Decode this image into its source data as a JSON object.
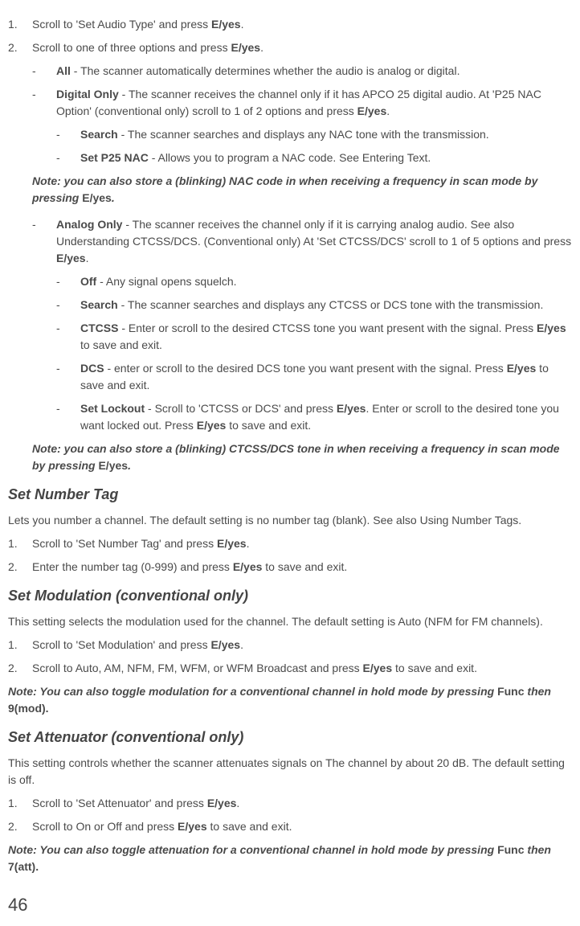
{
  "step1": {
    "num": "1.",
    "text_before": "Scroll to 'Set Audio Type' and press ",
    "bold": "E/yes",
    "text_after": "."
  },
  "step2": {
    "num": "2.",
    "text_before": "Scroll to one of three options and press ",
    "bold": "E/yes",
    "text_after": "."
  },
  "all_option": {
    "dash": "-",
    "bold": "All",
    "text": " - The scanner automatically determines whether the audio is analog or digital."
  },
  "digital_only": {
    "dash": "-",
    "bold1": "Digital Only",
    "text1": " - The scanner receives the channel only if it has APCO 25 digital audio. At 'P25 NAC Option' (conventional only) scroll to 1 of 2 options and press ",
    "bold2": "E/yes",
    "text2": "."
  },
  "search_digital": {
    "dash": "-",
    "bold": "Search",
    "text": " - The scanner searches and displays any NAC tone with the transmission."
  },
  "set_p25_nac": {
    "dash": "-",
    "bold": "Set P25 NAC",
    "text": " - Allows you to program a NAC code. See Entering Text."
  },
  "note1": {
    "italic": "Note: you can also store a (blinking) NAC code in when receiving a frequency in scan mode by pressing ",
    "bold": "E/yes",
    "period": "."
  },
  "analog_only": {
    "dash": "-",
    "bold1": "Analog Only",
    "text1": " - The scanner receives the channel only if it is carrying analog audio. See also Understanding CTCSS/DCS. (Conventional only) At 'Set CTCSS/DCS' scroll to 1 of 5 options and press ",
    "bold2": "E/yes",
    "text2": "."
  },
  "off_option": {
    "dash": "-",
    "bold": "Off",
    "text": " - Any signal opens squelch."
  },
  "search_analog": {
    "dash": "-",
    "bold": "Search",
    "text": " - The scanner searches and displays any CTCSS or DCS tone with the transmission."
  },
  "ctcss": {
    "dash": "-",
    "bold1": "CTCSS",
    "text1": " - Enter or scroll to the desired CTCSS tone you want present with the signal. Press ",
    "bold2": "E/yes",
    "text2": " to save and exit."
  },
  "dcs": {
    "dash": "-",
    "bold1": "DCS",
    "text1": " - enter or scroll to the desired DCS tone you want present with the signal. Press ",
    "bold2": "E/yes",
    "text2": " to save and exit."
  },
  "set_lockout": {
    "dash": "-",
    "bold1": "Set Lockout",
    "text1": " - Scroll to 'CTCSS or DCS' and press ",
    "bold2": "E/yes",
    "text2": ". Enter or scroll to the desired tone you want locked out. Press ",
    "bold3": "E/yes",
    "text3": " to save and exit."
  },
  "note2": {
    "italic": "Note: you can also store a (blinking) CTCSS/DCS tone in when receiving a frequency in scan mode by pressing ",
    "bold": "E/yes",
    "period": "."
  },
  "heading_number_tag": "Set Number Tag",
  "number_tag_intro": "Lets you number a channel. The default setting is no number tag (blank). See also Using Number Tags.",
  "number_tag_step1": {
    "num": "1.",
    "text_before": "Scroll to 'Set Number Tag' and press ",
    "bold": "E/yes",
    "text_after": "."
  },
  "number_tag_step2": {
    "num": "2.",
    "text_before": "Enter the number tag (0-999) and press ",
    "bold": "E/yes",
    "text_after": " to save and exit."
  },
  "heading_modulation": "Set Modulation (conventional only)",
  "modulation_intro": "This setting selects the modulation used for the channel. The default setting is Auto (NFM for FM channels).",
  "modulation_step1": {
    "num": "1.",
    "text_before": "Scroll to 'Set Modulation' and press ",
    "bold": "E/yes",
    "text_after": "."
  },
  "modulation_step2": {
    "num": "2.",
    "text_before": "Scroll to Auto, AM, NFM, FM, WFM, or WFM Broadcast and press ",
    "bold": "E/yes",
    "text_after": " to save and exit."
  },
  "modulation_note": {
    "italic1": "Note: You can also toggle modulation for a conventional channel in hold mode by pressing ",
    "bold1": "Func",
    "italic2": " then ",
    "bold2": "9(mod)."
  },
  "heading_attenuator": "Set Attenuator (conventional only)",
  "attenuator_intro": "This setting controls whether the scanner attenuates signals on The channel by about 20 dB. The default setting is off.",
  "attenuator_step1": {
    "num": "1.",
    "text_before": "Scroll to 'Set Attenuator' and press ",
    "bold": "E/yes",
    "text_after": "."
  },
  "attenuator_step2": {
    "num": "2.",
    "text_before": "Scroll to On or Off and press ",
    "bold": "E/yes",
    "text_after": " to save and exit."
  },
  "attenuator_note": {
    "italic1": "Note: You can also toggle attenuation for a conventional channel in hold mode by pressing ",
    "bold1": "Func",
    "italic2": " then ",
    "bold2": "7(att)."
  },
  "page_number": "46"
}
